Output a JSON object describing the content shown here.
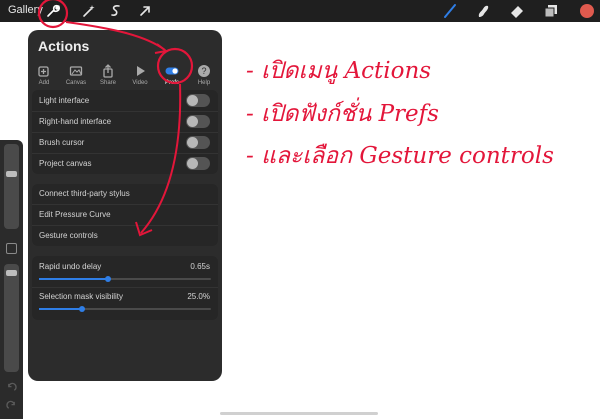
{
  "topbar": {
    "gallery_label": "Gallery",
    "left_tools": [
      {
        "icon": "wrench-icon",
        "name": "Actions"
      },
      {
        "icon": "magic-wand-icon",
        "name": "Adjustments"
      },
      {
        "icon": "selection-icon",
        "name": "Selection"
      },
      {
        "icon": "transform-arrow-icon",
        "name": "Transform"
      }
    ],
    "right_tools": [
      {
        "icon": "brush-icon",
        "name": "Paint"
      },
      {
        "icon": "smudge-icon",
        "name": "Smudge"
      },
      {
        "icon": "eraser-icon",
        "name": "Erase"
      },
      {
        "icon": "layers-icon",
        "name": "Layers"
      },
      {
        "icon": "color-swatch-icon",
        "name": "Colors"
      }
    ],
    "accent_color": "#2f7ee6",
    "swatch_color": "#e05a4e"
  },
  "actions_panel": {
    "title": "Actions",
    "tabs": [
      {
        "label": "Add",
        "icon": "add-image-icon"
      },
      {
        "label": "Canvas",
        "icon": "canvas-icon"
      },
      {
        "label": "Share",
        "icon": "share-icon"
      },
      {
        "label": "Video",
        "icon": "play-icon"
      },
      {
        "label": "Prefs",
        "icon": "toggle-icon",
        "active": true
      },
      {
        "label": "Help",
        "icon": "help-icon"
      }
    ],
    "toggles": [
      {
        "label": "Light interface",
        "on": false
      },
      {
        "label": "Right-hand interface",
        "on": false
      },
      {
        "label": "Brush cursor",
        "on": false
      },
      {
        "label": "Project canvas",
        "on": false
      }
    ],
    "links": [
      {
        "label": "Connect third-party stylus"
      },
      {
        "label": "Edit Pressure Curve"
      },
      {
        "label": "Gesture controls"
      }
    ],
    "sliders": [
      {
        "label": "Rapid undo delay",
        "value_text": "0.65s",
        "fraction": 0.4
      },
      {
        "label": "Selection mask visibility",
        "value_text": "25.0%",
        "fraction": 0.25
      }
    ]
  },
  "annotations": {
    "color": "#e3163a",
    "lines": [
      "- เปิดเมนู Actions",
      "- เปิดฟังก์ชั่น Prefs",
      "- และเลือก Gesture controls"
    ]
  }
}
